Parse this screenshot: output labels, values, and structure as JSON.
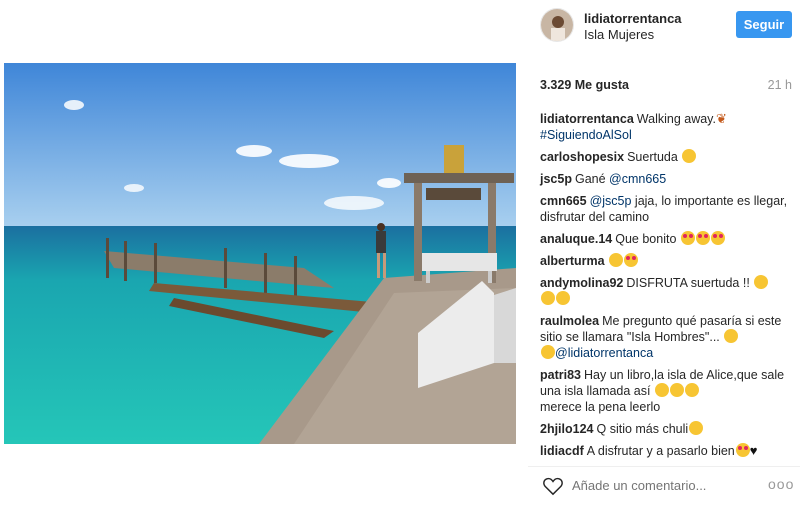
{
  "header": {
    "username": "lidiatorrentanca",
    "location": "Isla Mujeres",
    "follow_label": "Seguir"
  },
  "stats": {
    "likes": "3.329 Me gusta",
    "time": "21 h"
  },
  "comments": [
    {
      "user": "lidiatorrentanca",
      "text": "Walking away.",
      "link": "#SiguiendoAlSol"
    },
    {
      "user": "carloshopesix",
      "text": "Suertuda"
    },
    {
      "user": "jsc5p",
      "text": "Gané",
      "link": "@cmn665"
    },
    {
      "user": "cmn665",
      "link": "@jsc5p",
      "text": "jaja, lo importante es llegar, disfrutar del camino"
    },
    {
      "user": "analuque.14",
      "text": "Que bonito"
    },
    {
      "user": "alberturma",
      "text": ""
    },
    {
      "user": "andymolina92",
      "text": "DISFRUTA suertuda !!"
    },
    {
      "user": "raulmolea",
      "text": "Me pregunto qué pasaría si este sitio se llamara \"Isla Hombres\"...",
      "link": "@lidiatorrentanca"
    },
    {
      "user": "patri83",
      "text": "Hay un libro,la isla de Alice,que sale una isla llamada así",
      "text2": "merece la pena leerlo"
    },
    {
      "user": "2hjilo124",
      "text": "Q sitio más chuli"
    },
    {
      "user": "lidiacdf",
      "text": "A disfrutar y a pasarlo bien"
    }
  ],
  "add_comment": {
    "placeholder": "Añade un comentario...",
    "more": "ooo"
  },
  "icons": {
    "like": "heart-outline-icon",
    "more": "more-options-icon"
  },
  "colors": {
    "follow_button": "#3897f0",
    "link": "#003569",
    "sea": "#1fb8b4",
    "sky": "#4a93de"
  }
}
